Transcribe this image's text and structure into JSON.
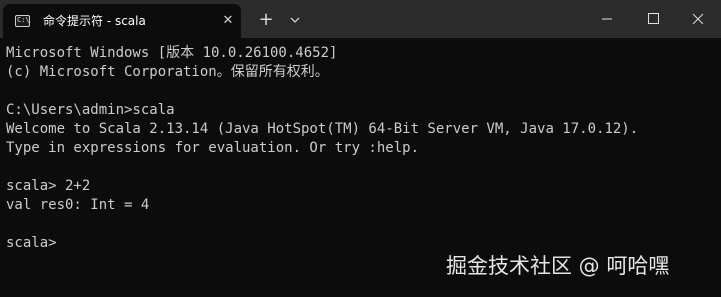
{
  "tab": {
    "title": "命令提示符 - scala",
    "icon": "terminal-icon",
    "icon_glyph": "C:\\",
    "close_glyph": "✕"
  },
  "tabbar": {
    "new_tab_glyph": "+",
    "dropdown_icon": "chevron-down-icon"
  },
  "window_controls": {
    "minimize_icon": "minimize-icon",
    "maximize_icon": "maximize-icon",
    "close_icon": "close-icon"
  },
  "terminal": {
    "lines": [
      "Microsoft Windows [版本 10.0.26100.4652]",
      "(c) Microsoft Corporation。保留所有权利。",
      "C:\\Users\\admin>scala",
      "Welcome to Scala 2.13.14 (Java HotSpot(TM) 64-Bit Server VM, Java 17.0.12).",
      "Type in expressions for evaluation. Or try :help.",
      "scala> 2+2",
      "val res0: Int = 4",
      "scala>"
    ]
  },
  "watermark": "掘金技术社区 @ 呵哈嘿",
  "colors": {
    "background": "#0c0c0c",
    "titlebar": "#2b2b2b",
    "text": "#cccccc"
  }
}
